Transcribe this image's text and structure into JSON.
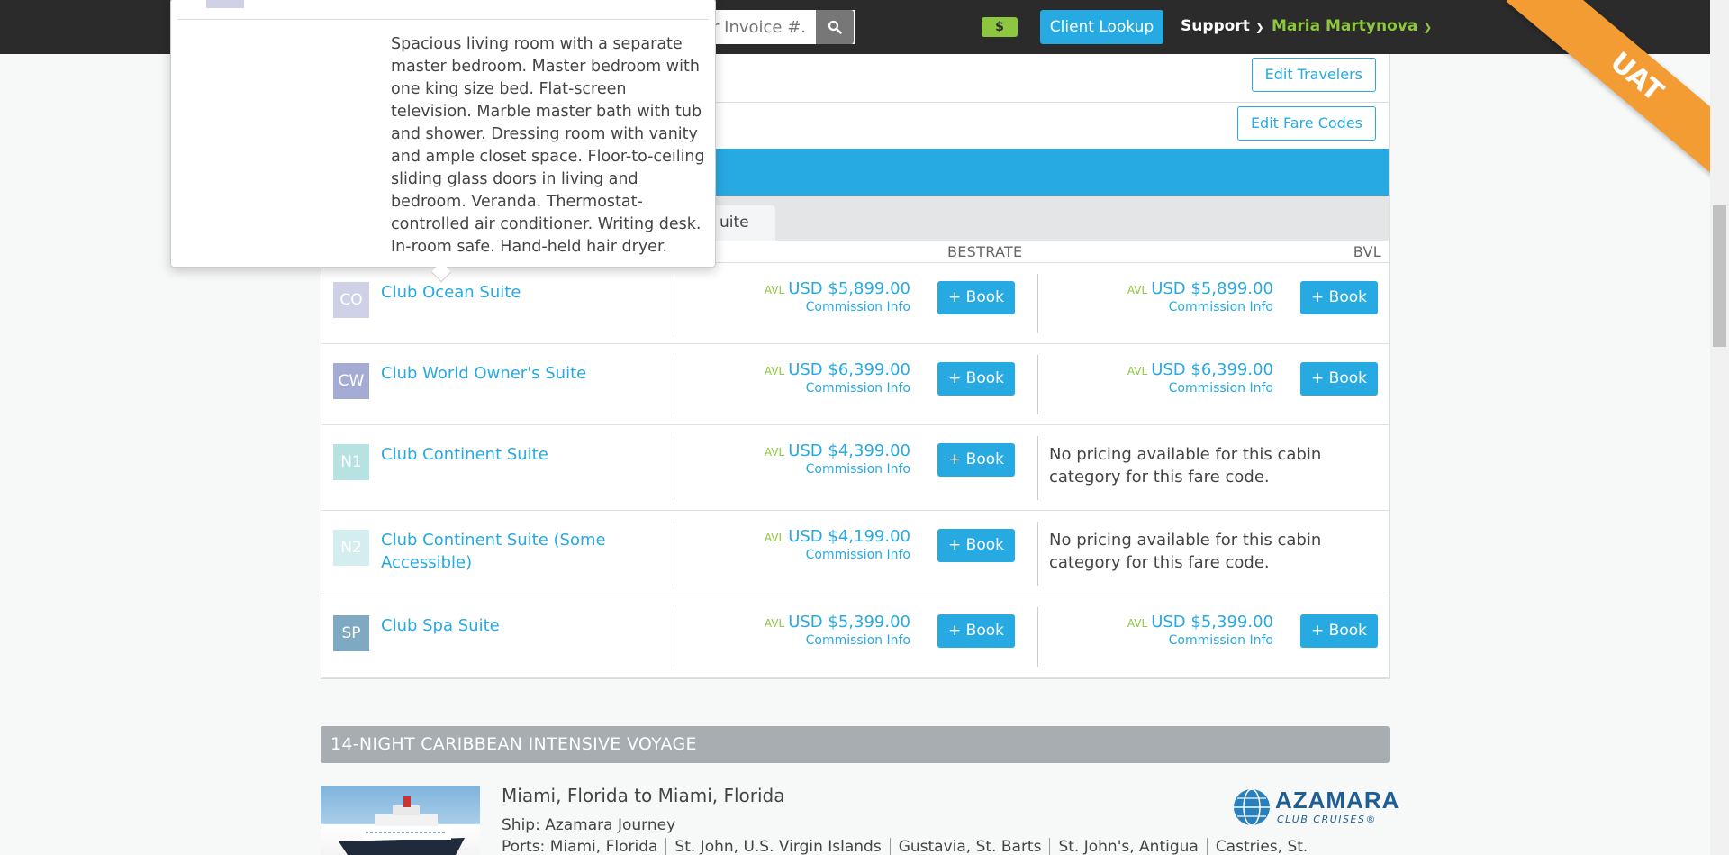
{
  "navbar": {
    "search_placeholder": "or Invoice #.",
    "dollar_label": "$",
    "client_lookup_label": "Client Lookup",
    "support_label": "Support",
    "user_name": "Maria Martynova"
  },
  "ribbon": {
    "label": "UAT"
  },
  "panel": {
    "edit_travelers_label": "Edit Travelers",
    "edit_fare_codes_label": "Edit Fare Codes",
    "active_tab_label": "uite",
    "columns": {
      "bestrate": "BESTRATE",
      "bvl": "BVL"
    },
    "cabins": [
      {
        "code": "CO",
        "name": "Club Ocean Suite",
        "badge_color": "#cfd1e6",
        "bestrate": {
          "avl": "AVL",
          "price": "USD $5,899.00",
          "commission": "Commission Info",
          "book": "+ Book"
        },
        "bvl": {
          "avl": "AVL",
          "price": "USD $5,899.00",
          "commission": "Commission Info",
          "book": "+ Book"
        }
      },
      {
        "code": "CW",
        "name": "Club World Owner's Suite",
        "badge_color": "#a5acd3",
        "bestrate": {
          "avl": "AVL",
          "price": "USD $6,399.00",
          "commission": "Commission Info",
          "book": "+ Book"
        },
        "bvl": {
          "avl": "AVL",
          "price": "USD $6,399.00",
          "commission": "Commission Info",
          "book": "+ Book"
        }
      },
      {
        "code": "N1",
        "name": "Club Continent Suite",
        "badge_color": "#b7e2e2",
        "bestrate": {
          "avl": "AVL",
          "price": "USD $4,399.00",
          "commission": "Commission Info",
          "book": "+ Book"
        },
        "bvl_message": "No pricing available for this cabin category for this fare code."
      },
      {
        "code": "N2",
        "name": "Club Continent Suite (Some Accessible)",
        "badge_color": "#d4eef0",
        "bestrate": {
          "avl": "AVL",
          "price": "USD $4,199.00",
          "commission": "Commission Info",
          "book": "+ Book"
        },
        "bvl_message": "No pricing available for this cabin category for this fare code."
      },
      {
        "code": "SP",
        "name": "Club Spa Suite",
        "badge_color": "#7fa9c3",
        "bestrate": {
          "avl": "AVL",
          "price": "USD $5,399.00",
          "commission": "Commission Info",
          "book": "+ Book"
        },
        "bvl": {
          "avl": "AVL",
          "price": "USD $5,399.00",
          "commission": "Commission Info",
          "book": "+ Book"
        }
      }
    ]
  },
  "voyage": {
    "title": "14-NIGHT CARIBBEAN INTENSIVE VOYAGE",
    "route": "Miami, Florida to Miami, Florida",
    "ship": "Ship: Azamara Journey",
    "ports": [
      "Ports: Miami, Florida",
      "St. John, U.S. Virgin Islands",
      "Gustavia, St. Barts",
      "St. John's, Antigua",
      "Castries, St."
    ],
    "logo_name": "AZAMARA",
    "logo_sub": "CLUB CRUISES",
    "logo_reg": "®"
  },
  "popover": {
    "description": "Spacious living room with a separate master bedroom. Master bedroom with one king size bed. Flat-screen television. Marble master bath with tub and shower. Dressing room with vanity and ample closet space. Floor-to-ceiling sliding glass doors in living and bedroom. Veranda. Thermostat-controlled air conditioner. Writing desk. In-room safe. Hand-held hair dryer."
  }
}
